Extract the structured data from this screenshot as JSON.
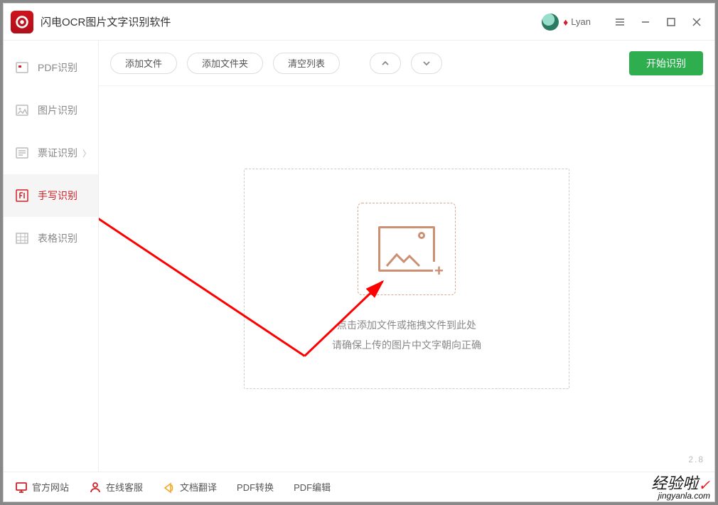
{
  "app": {
    "title": "闪电OCR图片文字识别软件"
  },
  "user": {
    "name": "Lyan"
  },
  "sidebar": {
    "items": [
      {
        "label": "PDF识别"
      },
      {
        "label": "图片识别"
      },
      {
        "label": "票证识别"
      },
      {
        "label": "手写识别"
      },
      {
        "label": "表格识别"
      }
    ]
  },
  "toolbar": {
    "add_file": "添加文件",
    "add_folder": "添加文件夹",
    "clear_list": "清空列表",
    "start": "开始识别"
  },
  "drop": {
    "line1": "点击添加文件或拖拽文件到此处",
    "line2": "请确保上传的图片中文字朝向正确"
  },
  "footer": {
    "site": "官方网站",
    "service": "在线客服",
    "translate": "文档翻译",
    "pdf_convert": "PDF转换",
    "pdf_edit": "PDF编辑",
    "version": "2.8"
  },
  "watermark": {
    "line1": "经验啦",
    "line2": "jingyanla.com"
  }
}
